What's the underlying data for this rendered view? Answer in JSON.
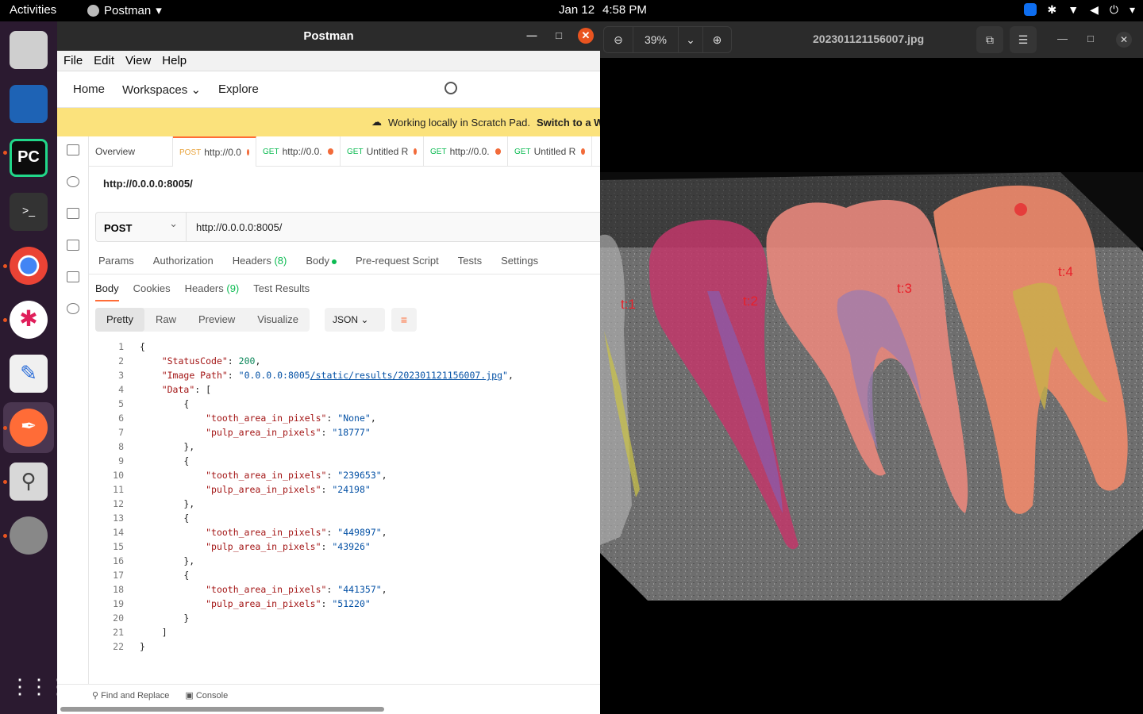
{
  "topbar": {
    "activities": "Activities",
    "app_name": "Postman",
    "date": "Jan 12",
    "time": "4:58 PM"
  },
  "postman": {
    "title": "Postman",
    "menu": [
      "File",
      "Edit",
      "View",
      "Help"
    ],
    "nav": {
      "home": "Home",
      "workspaces": "Workspaces",
      "explore": "Explore"
    },
    "banner": {
      "text": "Working locally in Scratch Pad.",
      "link": "Switch to a Wo"
    },
    "tabs": [
      {
        "label": "Overview",
        "method": ""
      },
      {
        "label": "http://0.0",
        "method": "POST"
      },
      {
        "label": "http://0.0.",
        "method": "GET"
      },
      {
        "label": "Untitled R",
        "method": "GET"
      },
      {
        "label": "http://0.0.",
        "method": "GET"
      },
      {
        "label": "Untitled R",
        "method": "GET"
      }
    ],
    "request_title": "http://0.0.0.0:8005/",
    "method": "POST",
    "url": "http://0.0.0.0:8005/",
    "request_tabs": {
      "params": "Params",
      "authorization": "Authorization",
      "headers": "Headers",
      "headers_count": "(8)",
      "body": "Body",
      "prerequest": "Pre-request Script",
      "tests": "Tests",
      "settings": "Settings"
    },
    "response_tabs": {
      "body": "Body",
      "cookies": "Cookies",
      "headers": "Headers",
      "headers_count": "(9)",
      "test_results": "Test Results"
    },
    "format_tabs": {
      "pretty": "Pretty",
      "raw": "Raw",
      "preview": "Preview",
      "visualize": "Visualize"
    },
    "format_select": "JSON",
    "response": {
      "status_key": "\"StatusCode\"",
      "status_val": "200",
      "path_key": "\"Image Path\"",
      "path_host": "\"0.0.0.0:8005",
      "path_link": "/static/results/202301121156007.jpg",
      "path_end": "\"",
      "data_key": "\"Data\"",
      "tooth_key": "\"tooth_area_in_pixels\"",
      "pulp_key": "\"pulp_area_in_pixels\"",
      "items": [
        {
          "tooth": "\"None\"",
          "pulp": "\"18777\""
        },
        {
          "tooth": "\"239653\"",
          "pulp": "\"24198\""
        },
        {
          "tooth": "\"449897\"",
          "pulp": "\"43926\""
        },
        {
          "tooth": "\"441357\"",
          "pulp": "\"51220\""
        }
      ]
    },
    "statusbar": {
      "find_replace": "Find and Replace",
      "console": "Console"
    }
  },
  "viewer": {
    "zoom": "39%",
    "title": "202301121156007.jpg",
    "labels": {
      "t1": "t:1",
      "t2": "t:2",
      "t3": "t:3",
      "t4": "t:4"
    }
  },
  "colors": {
    "accent": "#ff6c37",
    "banner": "#fbe27c",
    "dock": "#2b1a30"
  }
}
